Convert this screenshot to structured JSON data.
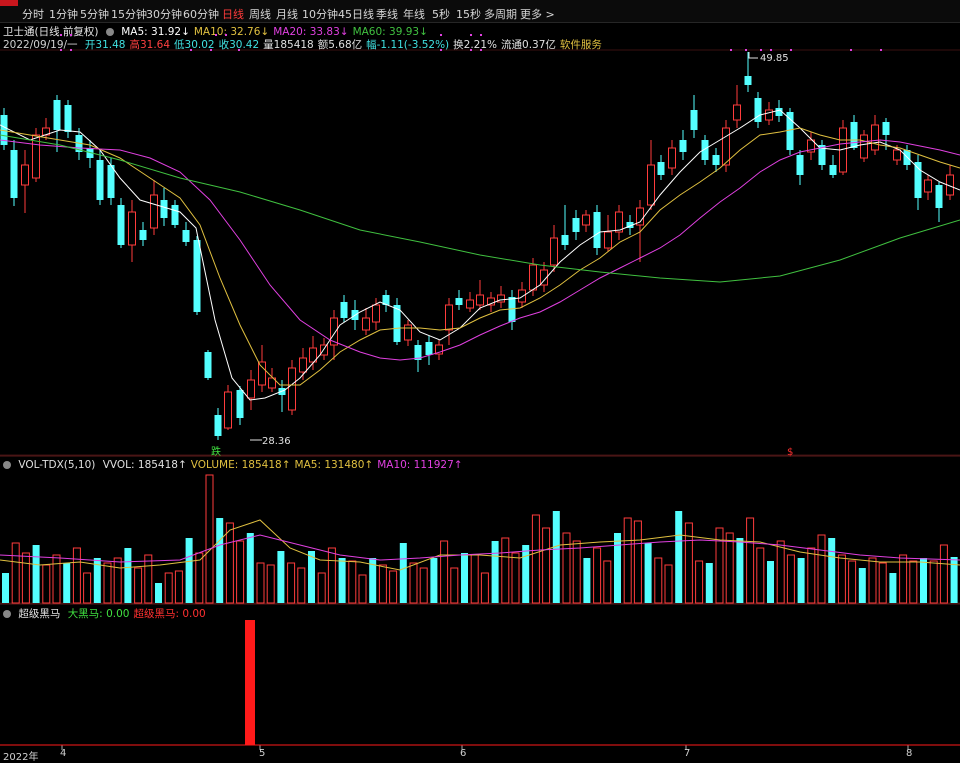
{
  "toolbar": {
    "periods": [
      "分时",
      "1分钟",
      "5分钟",
      "15分钟",
      "30分钟",
      "60分钟",
      "日线",
      "周线",
      "月线",
      "10分钟",
      "45日线",
      "季线",
      "年线",
      "5秒",
      "15秒",
      "多周期",
      "更多 >"
    ],
    "active": "日线"
  },
  "header": {
    "title": "卫士通(日线 前复权)",
    "ma": [
      {
        "label": "MA5: 31.92↓",
        "color": "#ffffff"
      },
      {
        "label": "MA10: 32.76↓",
        "color": "#e0c040"
      },
      {
        "label": "MA20: 33.83↓",
        "color": "#e040e0"
      },
      {
        "label": "MA60: 39.93↓",
        "color": "#40c040"
      }
    ],
    "info_date": "2022/09/19/一",
    "info": [
      {
        "label": "开31.48",
        "color": "#40e0e0"
      },
      {
        "label": "高31.64",
        "color": "#ff4040"
      },
      {
        "label": "低30.02",
        "color": "#40e0e0"
      },
      {
        "label": "收30.42",
        "color": "#40e0e0"
      },
      {
        "label": "量185418",
        "color": "#e0e0e0"
      },
      {
        "label": "额5.68亿",
        "color": "#e0e0e0"
      },
      {
        "label": "幅-1.11(-3.52%)",
        "color": "#40e0e0"
      },
      {
        "label": "换2.21%",
        "color": "#e0e0e0"
      },
      {
        "label": "流通0.37亿",
        "color": "#e0e0e0"
      },
      {
        "label": "软件服务",
        "color": "#e0c040"
      }
    ]
  },
  "price_panel": {
    "high_label": "49.85",
    "low_label": "28.36",
    "signal_label": "跌",
    "signal_label2": "$"
  },
  "volume_panel": {
    "indicator": "VOL-TDX(5,10)",
    "items": [
      {
        "label": "VVOL: 185418↑",
        "color": "#e0e0e0"
      },
      {
        "label": "VOLUME: 185418↑",
        "color": "#e0c040"
      },
      {
        "label": "MA5: 131480↑",
        "color": "#e0c040"
      },
      {
        "label": "MA10: 111927↑",
        "color": "#e040e0"
      }
    ]
  },
  "horse_panel": {
    "indicator": "超级黑马",
    "items": [
      {
        "label": "大黑马: 0.00",
        "color": "#40e040"
      },
      {
        "label": "超级黑马: 0.00",
        "color": "#ff3030"
      }
    ]
  },
  "x_axis": {
    "labels": [
      "2022年",
      "4",
      "5",
      "6",
      "7",
      "8"
    ]
  },
  "colors": {
    "up": "#ff3c3c",
    "down": "#54ffff",
    "ma5": "#ffffff",
    "ma10": "#e0c040",
    "ma20": "#e040e0",
    "ma60": "#40c040",
    "bg": "#000000"
  }
}
